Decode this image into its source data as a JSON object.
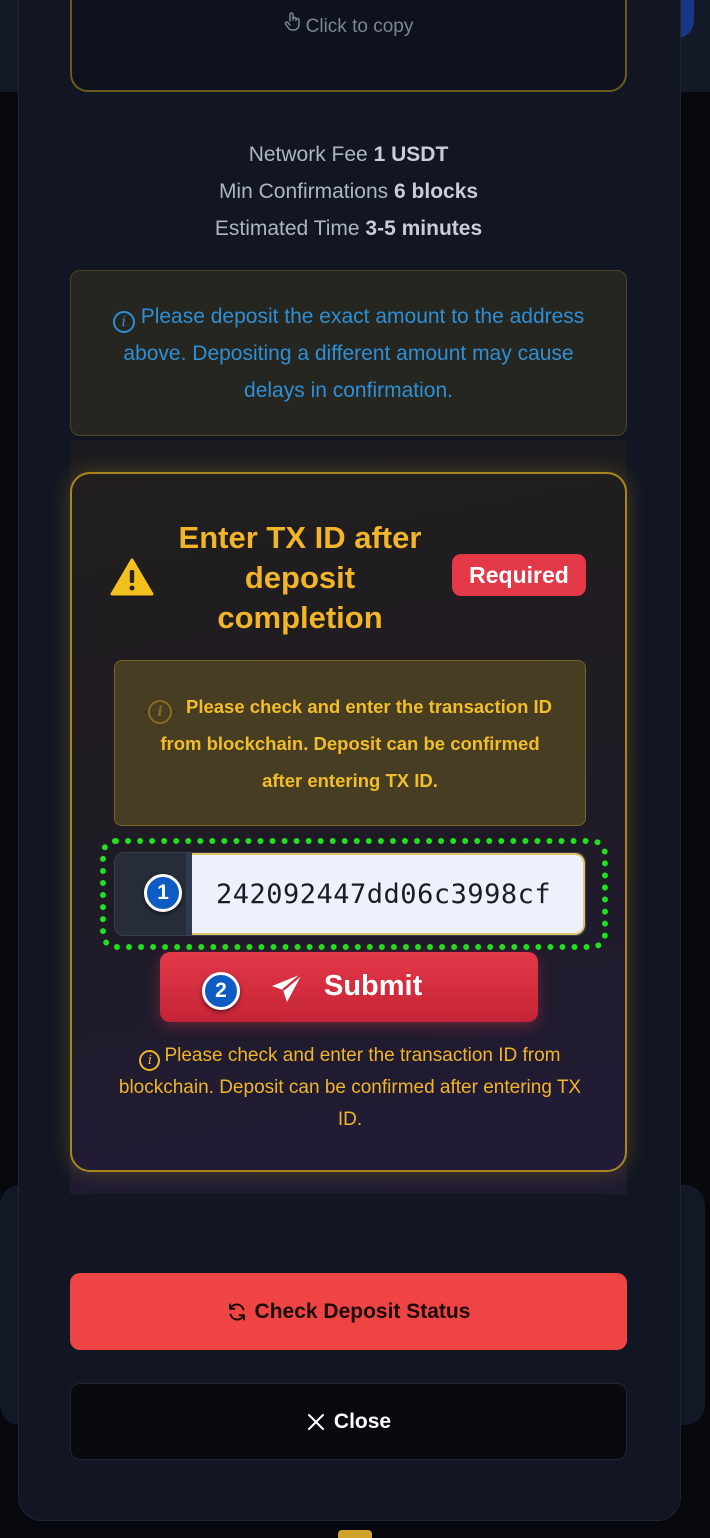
{
  "address_box": {
    "copy_hint": "Click to copy"
  },
  "info": {
    "fee_label": "Network Fee",
    "fee_value": "1 USDT",
    "conf_label": "Min Confirmations",
    "conf_value": "6 blocks",
    "time_label": "Estimated Time",
    "time_value": "3-5 minutes"
  },
  "notice": {
    "text": "Please deposit the exact amount to the address above. Depositing a different amount may cause delays in confirmation."
  },
  "tx_card": {
    "title": "Enter TX ID after deposit completion",
    "badge": "Required",
    "notice": "Please check and enter the transaction ID from blockchain. Deposit can be confirmed after entering TX ID.",
    "input_value": "242092447dd06c3998cf",
    "step1": "1",
    "step2": "2",
    "submit_label": "Submit",
    "help": "Please check and enter the transaction ID from blockchain. Deposit can be confirmed after entering TX ID."
  },
  "actions": {
    "check_status": "Check Deposit Status",
    "close": "Close"
  },
  "colors": {
    "accent_yellow": "#f2b52a",
    "danger_red": "#e23848",
    "check_button": "#ef4444",
    "info_blue": "#2f8fd6",
    "highlight_green": "#22e01f"
  },
  "icons": {
    "copy": "hand-pointer-icon",
    "info": "info-circle-icon",
    "warning": "warning-triangle-icon",
    "submit": "paper-plane-icon",
    "refresh": "refresh-icon",
    "close": "x-icon"
  }
}
